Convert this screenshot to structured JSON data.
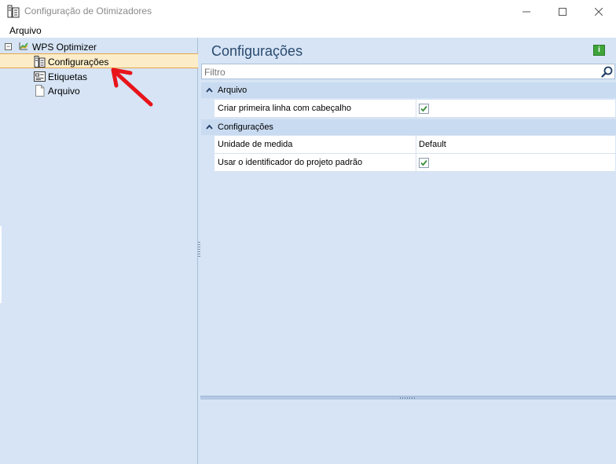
{
  "window": {
    "title": "Configuração de Otimizadores",
    "controls": {
      "minimize": "—",
      "maximize": "☐",
      "close": "✕"
    }
  },
  "menu": {
    "items": [
      {
        "label": "Arquivo"
      }
    ]
  },
  "tree": {
    "root": {
      "label": "WPS Optimizer",
      "expander": "−",
      "icon": "chart-icon"
    },
    "children": [
      {
        "label": "Configurações",
        "icon": "settings-doc-icon",
        "selected": true
      },
      {
        "label": "Etiquetas",
        "icon": "label-icon",
        "selected": false
      },
      {
        "label": "Arquivo",
        "icon": "file-icon",
        "selected": false
      }
    ]
  },
  "main": {
    "title": "Configurações",
    "info_label": "i",
    "filter": {
      "placeholder": "Filtro",
      "value": ""
    },
    "sections": [
      {
        "label": "Arquivo",
        "rows": [
          {
            "name": "Criar primeira linha com cabeçalho",
            "type": "checkbox",
            "checked": true
          }
        ]
      },
      {
        "label": "Configurações",
        "rows": [
          {
            "name": "Unidade de medida",
            "type": "text",
            "value": "Default"
          },
          {
            "name": "Usar o identificador do projeto padrão",
            "type": "checkbox",
            "checked": true
          }
        ]
      }
    ]
  },
  "colors": {
    "panel": "#d6e4f5",
    "selection": "#fcedc8",
    "selection_border": "#e8a44c",
    "accent_title": "#2a4a6e",
    "check": "#3a8d3a",
    "annotation_arrow": "#e8141a"
  }
}
